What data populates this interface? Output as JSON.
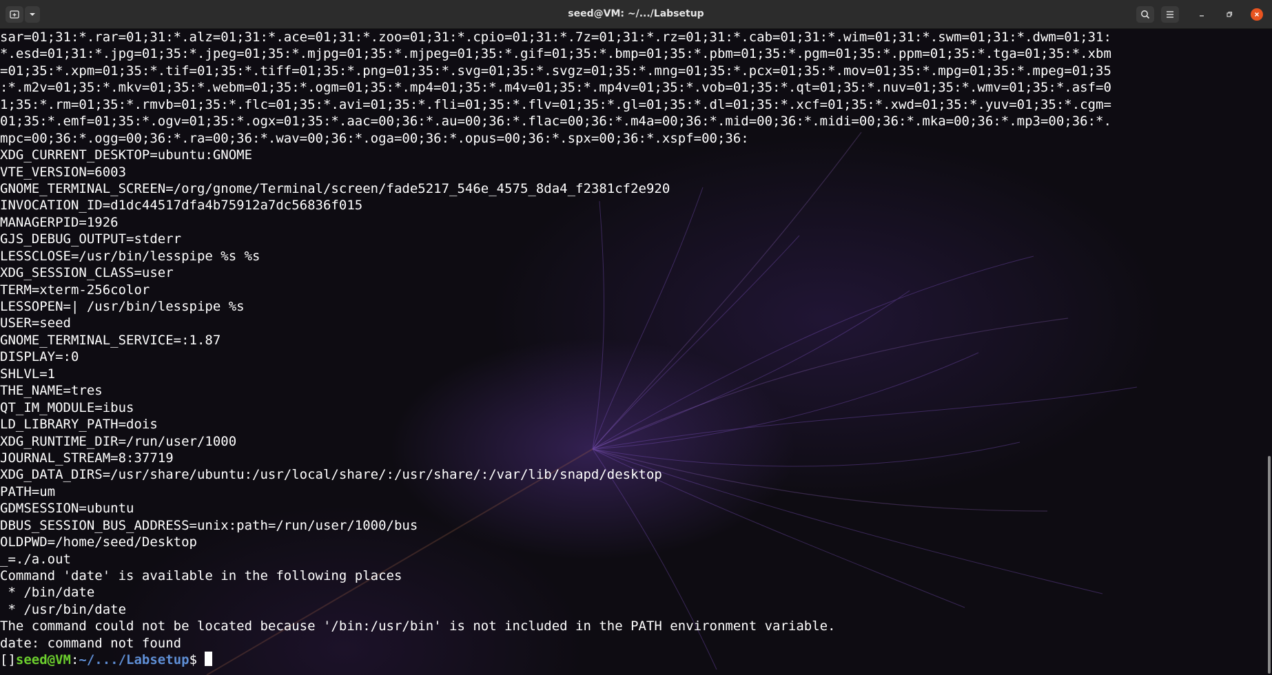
{
  "window": {
    "title": "seed@VM: ~/.../Labsetup",
    "new_tab_icon": "new-tab-icon",
    "menu_caret_icon": "chevron-down-icon",
    "search_icon": "search-icon",
    "hamburger_icon": "hamburger-menu-icon"
  },
  "terminal": {
    "lines": [
      "sar=01;31:*.rar=01;31:*.alz=01;31:*.ace=01;31:*.zoo=01;31:*.cpio=01;31:*.7z=01;31:*.rz=01;31:*.cab=01;31:*.wim=01;31:*.swm=01;31:*.dwm=01;31:",
      "*.esd=01;31:*.jpg=01;35:*.jpeg=01;35:*.mjpg=01;35:*.mjpeg=01;35:*.gif=01;35:*.bmp=01;35:*.pbm=01;35:*.pgm=01;35:*.ppm=01;35:*.tga=01;35:*.xbm",
      "=01;35:*.xpm=01;35:*.tif=01;35:*.tiff=01;35:*.png=01;35:*.svg=01;35:*.svgz=01;35:*.mng=01;35:*.pcx=01;35:*.mov=01;35:*.mpg=01;35:*.mpeg=01;35",
      ":*.m2v=01;35:*.mkv=01;35:*.webm=01;35:*.ogm=01;35:*.mp4=01;35:*.m4v=01;35:*.mp4v=01;35:*.vob=01;35:*.qt=01;35:*.nuv=01;35:*.wmv=01;35:*.asf=0",
      "1;35:*.rm=01;35:*.rmvb=01;35:*.flc=01;35:*.avi=01;35:*.fli=01;35:*.flv=01;35:*.gl=01;35:*.dl=01;35:*.xcf=01;35:*.xwd=01;35:*.yuv=01;35:*.cgm=",
      "01;35:*.emf=01;35:*.ogv=01;35:*.ogx=01;35:*.aac=00;36:*.au=00;36:*.flac=00;36:*.m4a=00;36:*.mid=00;36:*.midi=00;36:*.mka=00;36:*.mp3=00;36:*.",
      "mpc=00;36:*.ogg=00;36:*.ra=00;36:*.wav=00;36:*.oga=00;36:*.opus=00;36:*.spx=00;36:*.xspf=00;36:",
      "XDG_CURRENT_DESKTOP=ubuntu:GNOME",
      "VTE_VERSION=6003",
      "GNOME_TERMINAL_SCREEN=/org/gnome/Terminal/screen/fade5217_546e_4575_8da4_f2381cf2e920",
      "INVOCATION_ID=d1dc44517dfa4b75912a7dc56836f015",
      "MANAGERPID=1926",
      "GJS_DEBUG_OUTPUT=stderr",
      "LESSCLOSE=/usr/bin/lesspipe %s %s",
      "XDG_SESSION_CLASS=user",
      "TERM=xterm-256color",
      "LESSOPEN=| /usr/bin/lesspipe %s",
      "USER=seed",
      "GNOME_TERMINAL_SERVICE=:1.87",
      "DISPLAY=:0",
      "SHLVL=1",
      "THE_NAME=tres",
      "QT_IM_MODULE=ibus",
      "LD_LIBRARY_PATH=dois",
      "XDG_RUNTIME_DIR=/run/user/1000",
      "JOURNAL_STREAM=8:37719",
      "XDG_DATA_DIRS=/usr/share/ubuntu:/usr/local/share/:/usr/share/:/var/lib/snapd/desktop",
      "PATH=um",
      "GDMSESSION=ubuntu",
      "DBUS_SESSION_BUS_ADDRESS=unix:path=/run/user/1000/bus",
      "OLDPWD=/home/seed/Desktop",
      "_=./a.out",
      "Command 'date' is available in the following places",
      " * /bin/date",
      " * /usr/bin/date",
      "The command could not be located because '/bin:/usr/bin' is not included in the PATH environment variable.",
      "date: command not found"
    ],
    "prompt": {
      "prefix": "[]",
      "user_host": "seed@VM",
      "separator": ":",
      "path": "~/.../Labsetup",
      "symbol": "$ "
    }
  },
  "colors": {
    "titlebar": "#2c2c2c",
    "close_button": "#e95420",
    "prompt_user": "#6ccf2e",
    "prompt_path": "#5f8fd6"
  }
}
